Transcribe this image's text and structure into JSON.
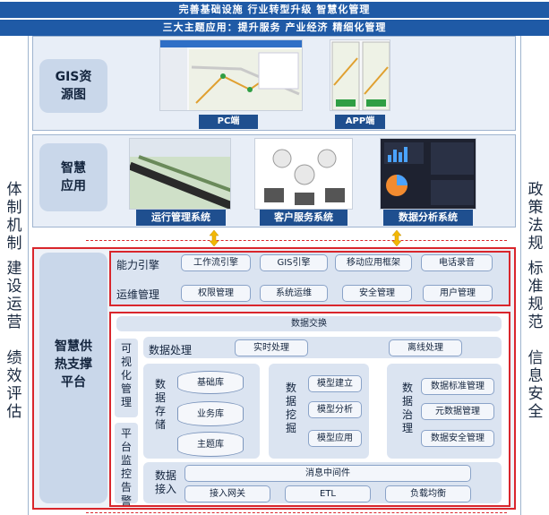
{
  "banners": [
    "完善基础设施    行业转型升级    智慧化管理",
    "三大主题应用：提升服务   产业经济    精细化管理"
  ],
  "left_side": [
    "体制机制",
    "建设运营",
    "绩效评估"
  ],
  "right_side": [
    "政策法规",
    "标准规范",
    "信息安全"
  ],
  "gis": {
    "title": "GIS资源图",
    "pc": "PC端",
    "app": "APP端"
  },
  "smart_app": {
    "title": "智慧应用",
    "systems": [
      "运行管理系统",
      "客户服务系统",
      "数据分析系统"
    ]
  },
  "platform": {
    "title": "智慧供热支撑平台"
  },
  "capability": {
    "label": "能力引擎",
    "items": [
      "工作流引擎",
      "GIS引擎",
      "移动应用框架",
      "电话录音"
    ]
  },
  "ops": {
    "label": "运维管理",
    "items": [
      "权限管理",
      "系统运维",
      "安全管理",
      "用户管理"
    ]
  },
  "data_exchange": "数据交换",
  "data_processing": {
    "label": "数据处理",
    "items": [
      "实时处理",
      "离线处理"
    ]
  },
  "visual_mgmt": "可视化管理",
  "platform_monitor": "平台监控告警",
  "storage": {
    "label": "数据存储",
    "items": [
      "基础库",
      "业务库",
      "主题库"
    ]
  },
  "mining": {
    "label": "数据挖掘",
    "items": [
      "模型建立",
      "模型分析",
      "模型应用"
    ]
  },
  "governance": {
    "label": "数据治理",
    "items": [
      "数据标准管理",
      "元数据管理",
      "数据安全管理"
    ]
  },
  "access": {
    "label": "数据接入",
    "mq": "消息中间件",
    "items": [
      "接入网关",
      "ETL",
      "负载均衡"
    ]
  },
  "colors": {
    "navy": "#1f4f8f",
    "banner": "#1f5aa6",
    "red": "#d9262c",
    "arrow": "#f2b705"
  }
}
